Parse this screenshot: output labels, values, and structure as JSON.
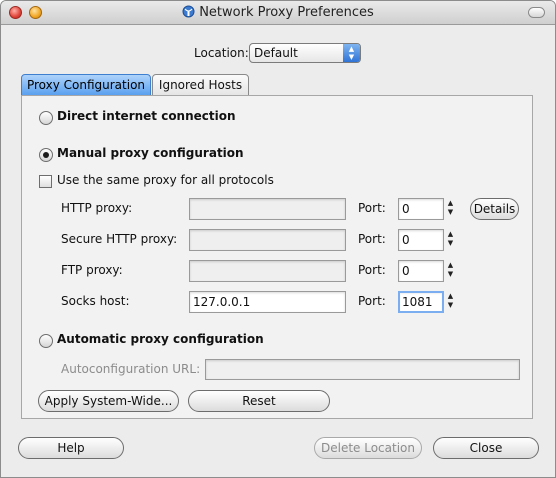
{
  "window": {
    "title": "Network Proxy Preferences"
  },
  "location": {
    "label": "Location:",
    "value": "Default"
  },
  "tabs": [
    {
      "label": "Proxy Configuration",
      "active": true
    },
    {
      "label": "Ignored Hosts",
      "active": false
    }
  ],
  "modes": {
    "direct": {
      "label": "Direct internet connection",
      "selected": false
    },
    "manual": {
      "label": "Manual proxy configuration",
      "selected": true
    },
    "automatic": {
      "label": "Automatic proxy configuration",
      "selected": false
    }
  },
  "same_proxy": {
    "label": "Use the same proxy for all protocols",
    "checked": false
  },
  "port_label": "Port:",
  "proxies": {
    "http": {
      "label": "HTTP proxy:",
      "host": "",
      "port": "0"
    },
    "https": {
      "label": "Secure HTTP proxy:",
      "host": "",
      "port": "0"
    },
    "ftp": {
      "label": "FTP proxy:",
      "host": "",
      "port": "0"
    },
    "socks": {
      "label": "Socks host:",
      "host": "127.0.0.1",
      "port": "1081"
    }
  },
  "details_button": "Details",
  "autoconfig": {
    "label": "Autoconfiguration URL:",
    "value": ""
  },
  "buttons": {
    "apply_system_wide": "Apply System-Wide...",
    "reset": "Reset",
    "help": "Help",
    "delete_location": "Delete Location",
    "close": "Close"
  },
  "colors": {
    "active_tab": "#5aa0ef",
    "window_bg": "#ececec"
  }
}
